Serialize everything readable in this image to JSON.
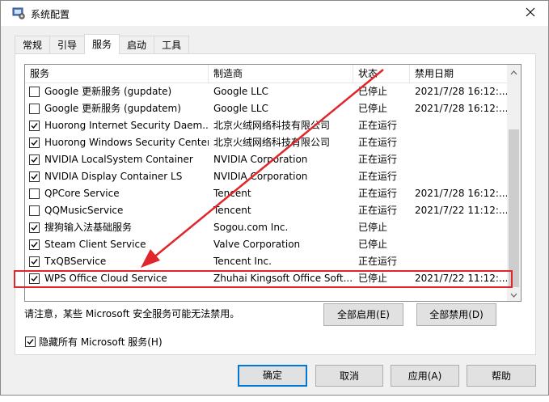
{
  "window": {
    "title": "系统配置"
  },
  "tabs": [
    {
      "label": "常规"
    },
    {
      "label": "引导"
    },
    {
      "label": "服务"
    },
    {
      "label": "启动"
    },
    {
      "label": "工具"
    }
  ],
  "services": {
    "columns": [
      "服务",
      "制造商",
      "状态",
      "禁用日期"
    ],
    "rows": [
      {
        "checked": false,
        "name": "Google 更新服务 (gupdate)",
        "vendor": "Google LLC",
        "status": "已停止",
        "date": "2021/7/28 16:12:..."
      },
      {
        "checked": false,
        "name": "Google 更新服务 (gupdatem)",
        "vendor": "Google LLC",
        "status": "已停止",
        "date": "2021/7/28 16:12:..."
      },
      {
        "checked": true,
        "name": "Huorong Internet Security Daem...",
        "vendor": "北京火绒网络科技有限公司",
        "status": "正在运行",
        "date": ""
      },
      {
        "checked": true,
        "name": "Huorong Windows Security Center",
        "vendor": "北京火绒网络科技有限公司",
        "status": "正在运行",
        "date": ""
      },
      {
        "checked": true,
        "name": "NVIDIA LocalSystem Container",
        "vendor": "NVIDIA Corporation",
        "status": "正在运行",
        "date": ""
      },
      {
        "checked": true,
        "name": "NVIDIA Display Container LS",
        "vendor": "NVIDIA Corporation",
        "status": "正在运行",
        "date": ""
      },
      {
        "checked": false,
        "name": "QPCore Service",
        "vendor": "Tencent",
        "status": "正在运行",
        "date": "2021/7/28 16:12:..."
      },
      {
        "checked": false,
        "name": "QQMusicService",
        "vendor": "Tencent",
        "status": "正在运行",
        "date": "2021/7/22 11:12:..."
      },
      {
        "checked": true,
        "name": "搜狗输入法基础服务",
        "vendor": "Sogou.com Inc.",
        "status": "已停止",
        "date": ""
      },
      {
        "checked": true,
        "name": "Steam Client Service",
        "vendor": "Valve Corporation",
        "status": "已停止",
        "date": ""
      },
      {
        "checked": true,
        "name": "TxQBService",
        "vendor": "Tencent Inc.",
        "status": "正在运行",
        "date": ""
      },
      {
        "checked": true,
        "name": "WPS Office Cloud Service",
        "vendor": "Zhuhai Kingsoft Office Soft...",
        "status": "已停止",
        "date": "2021/7/22 11:12:..."
      }
    ]
  },
  "notice": "请注意，某些 Microsoft 安全服务可能无法禁用。",
  "buttons": {
    "enable_all": "全部启用(E)",
    "disable_all": "全部禁用(D)",
    "ok": "确定",
    "cancel": "取消",
    "apply": "应用(A)",
    "help": "帮助"
  },
  "hide_ms": {
    "label": "隐藏所有 Microsoft 服务(H)",
    "checked": true
  },
  "colors": {
    "annotation": "#e0262a",
    "focus": "#0078d7"
  }
}
